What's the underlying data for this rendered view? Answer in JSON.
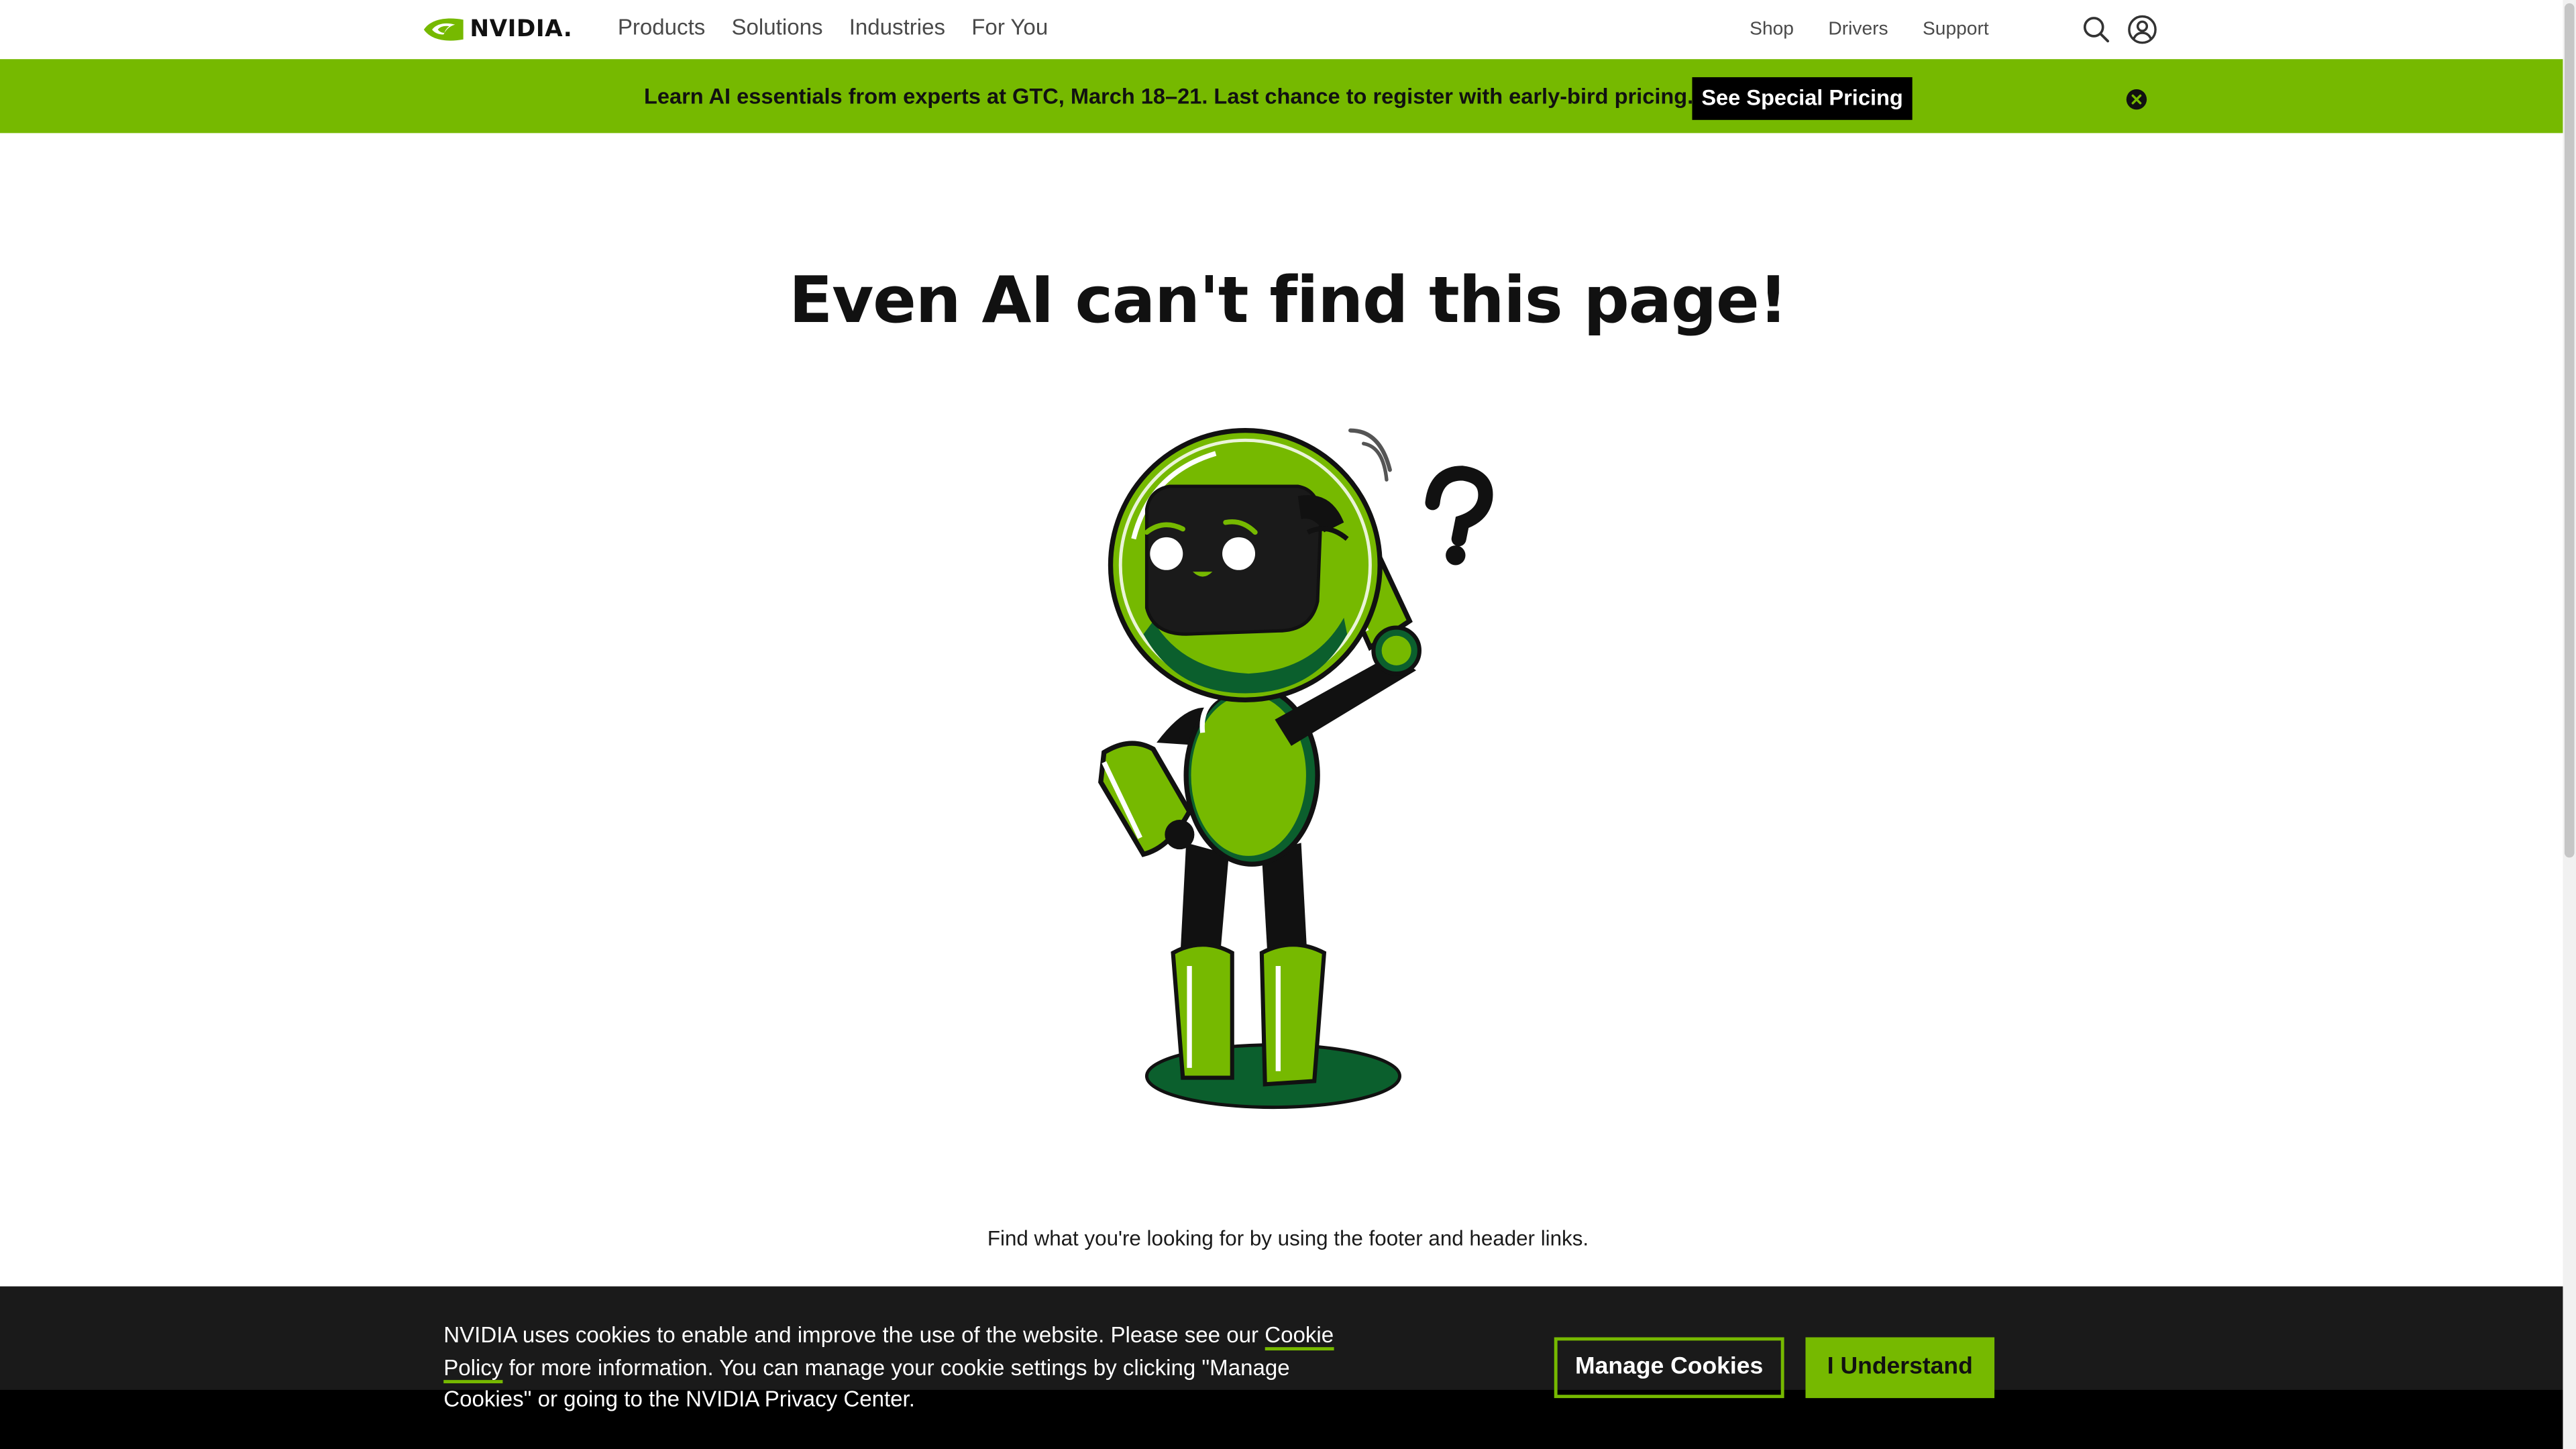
{
  "header": {
    "brand": "NVIDIA.",
    "primary_nav": [
      {
        "label": "Products"
      },
      {
        "label": "Solutions"
      },
      {
        "label": "Industries"
      },
      {
        "label": "For You"
      }
    ],
    "utility_nav": [
      {
        "label": "Shop"
      },
      {
        "label": "Drivers"
      },
      {
        "label": "Support"
      }
    ],
    "icons": [
      "search-icon",
      "account-icon"
    ]
  },
  "banner": {
    "text": "Learn AI essentials from experts at GTC, March 18–21. Last chance to register with early-bird pricing.",
    "cta_label": "See Special Pricing",
    "close_icon": "close-circle-icon"
  },
  "main": {
    "headline": "Even AI can't find this page!",
    "illustration": "confused-robot-illustration",
    "hint": "Find what you're looking for by using the footer and header links."
  },
  "cookie_notice": {
    "text_before_link": "NVIDIA uses cookies to enable and improve the use of the website. Please see our ",
    "link_label": "Cookie Policy",
    "text_after_link": " for more information. You can manage your cookie settings by clicking \"Manage Cookies\" or going to the NVIDIA Privacy Center.",
    "manage_label": "Manage Cookies",
    "accept_label": "I Understand"
  },
  "colors": {
    "brand_green": "#76b900",
    "dark_green": "#0b5f2d",
    "cookie_bg": "#1a1a1a",
    "text": "#111111"
  }
}
